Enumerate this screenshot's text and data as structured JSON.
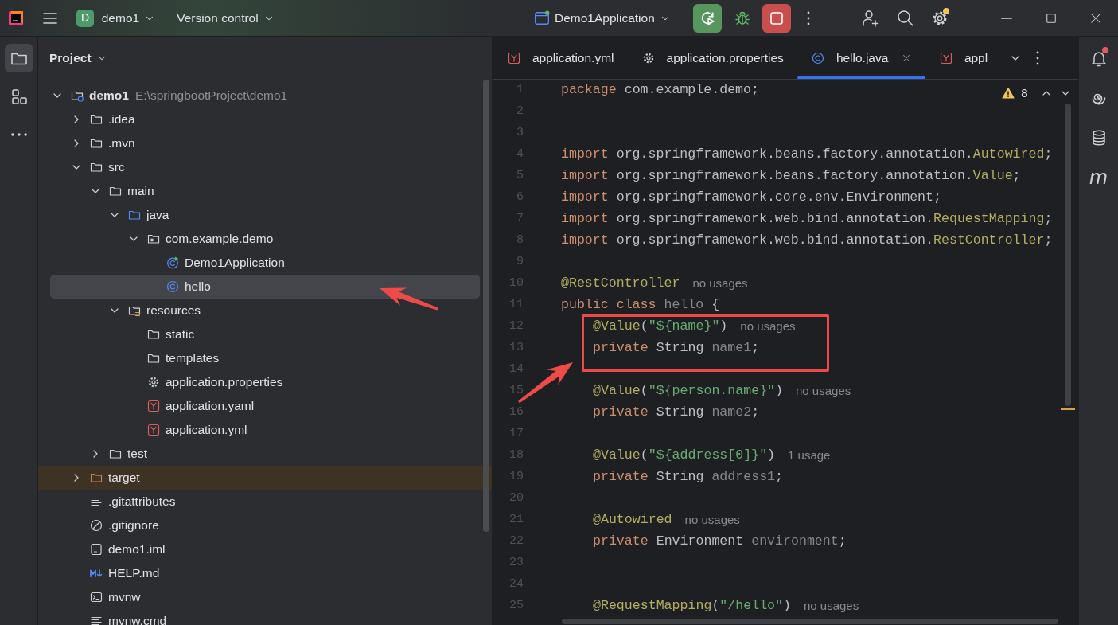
{
  "title_bar": {
    "project_badge": "D",
    "project": "demo1",
    "vcs": "Version control",
    "run_config": "Demo1Application",
    "settings_badge": true
  },
  "left_toolbar": [
    {
      "kind": "project",
      "selected": true
    },
    {
      "kind": "structure",
      "selected": false
    },
    {
      "kind": "more",
      "selected": false
    }
  ],
  "tool_window": {
    "title": "Project"
  },
  "tree": [
    {
      "label": "demo1",
      "kind": "module",
      "path": "E:\\springbootProject\\demo1",
      "expanded": true,
      "selected": false,
      "children": [
        {
          "label": ".idea",
          "kind": "folder",
          "expanded": false,
          "selected": false
        },
        {
          "label": ".mvn",
          "kind": "folder",
          "expanded": false,
          "selected": false
        },
        {
          "label": "src",
          "kind": "folder",
          "expanded": true,
          "selected": false,
          "children": [
            {
              "label": "main",
              "kind": "folder",
              "expanded": true,
              "selected": false,
              "children": [
                {
                  "label": "java",
                  "kind": "source-folder",
                  "expanded": true,
                  "selected": false,
                  "children": [
                    {
                      "label": "com.example.demo",
                      "kind": "package",
                      "expanded": true,
                      "selected": false,
                      "children": [
                        {
                          "label": "Demo1Application",
                          "kind": "spring-class",
                          "selected": false
                        },
                        {
                          "label": "hello",
                          "kind": "class",
                          "selected": true
                        }
                      ]
                    }
                  ]
                },
                {
                  "label": "resources",
                  "kind": "resources-folder",
                  "expanded": true,
                  "selected": false,
                  "children": [
                    {
                      "label": "static",
                      "kind": "folder",
                      "selected": false
                    },
                    {
                      "label": "templates",
                      "kind": "folder",
                      "selected": false
                    },
                    {
                      "label": "application.properties",
                      "kind": "settings",
                      "selected": false
                    },
                    {
                      "label": "application.yaml",
                      "kind": "yaml",
                      "selected": false
                    },
                    {
                      "label": "application.yml",
                      "kind": "yaml",
                      "selected": false
                    }
                  ]
                }
              ]
            },
            {
              "label": "test",
              "kind": "folder",
              "expanded": false,
              "selected": false
            }
          ]
        },
        {
          "label": "target",
          "kind": "excluded-folder",
          "expanded": false,
          "selected": false
        },
        {
          "label": ".gitattributes",
          "kind": "text",
          "selected": false
        },
        {
          "label": ".gitignore",
          "kind": "ignore",
          "selected": false
        },
        {
          "label": "demo1.iml",
          "kind": "iml",
          "selected": false
        },
        {
          "label": "HELP.md",
          "kind": "markdown",
          "selected": false
        },
        {
          "label": "mvnw",
          "kind": "shell",
          "selected": false
        },
        {
          "label": "mvnw.cmd",
          "kind": "text",
          "selected": false
        }
      ]
    }
  ],
  "tabs": [
    {
      "label": "application.yml",
      "kind": "yaml",
      "selected": false,
      "closable": false
    },
    {
      "label": "application.properties",
      "kind": "settings",
      "selected": false,
      "closable": false
    },
    {
      "label": "hello.java",
      "kind": "class",
      "selected": true,
      "closable": true
    },
    {
      "label": "appl",
      "kind": "yaml",
      "selected": false,
      "closable": false
    }
  ],
  "inspections": {
    "warnings": "8"
  },
  "code": [
    {
      "number": "1",
      "indented": false,
      "tokens": [
        {
          "kind": "kw",
          "text": "package"
        },
        {
          "kind": "plain",
          "text": " com.example.demo;"
        }
      ]
    },
    {
      "number": "2"
    },
    {
      "number": "3"
    },
    {
      "number": "4",
      "indented": false,
      "tokens": [
        {
          "kind": "kw",
          "text": "import"
        },
        {
          "kind": "plain",
          "text": " org.springframework.beans.factory.annotation."
        },
        {
          "kind": "ref",
          "text": "Autowired"
        },
        {
          "kind": "plain",
          "text": ";"
        }
      ]
    },
    {
      "number": "5",
      "indented": false,
      "tokens": [
        {
          "kind": "kw",
          "text": "import"
        },
        {
          "kind": "plain",
          "text": " org.springframework.beans.factory.annotation."
        },
        {
          "kind": "ref",
          "text": "Value"
        },
        {
          "kind": "plain",
          "text": ";"
        }
      ]
    },
    {
      "number": "6",
      "indented": false,
      "tokens": [
        {
          "kind": "kw",
          "text": "import"
        },
        {
          "kind": "plain",
          "text": " org.springframework.core.env.Environment;"
        }
      ]
    },
    {
      "number": "7",
      "indented": false,
      "tokens": [
        {
          "kind": "kw",
          "text": "import"
        },
        {
          "kind": "plain",
          "text": " org.springframework.web.bind.annotation."
        },
        {
          "kind": "ref",
          "text": "RequestMapping"
        },
        {
          "kind": "plain",
          "text": ";"
        }
      ]
    },
    {
      "number": "8",
      "indented": false,
      "tokens": [
        {
          "kind": "kw",
          "text": "import"
        },
        {
          "kind": "plain",
          "text": " org.springframework.web.bind.annotation."
        },
        {
          "kind": "ref",
          "text": "RestController"
        },
        {
          "kind": "plain",
          "text": ";"
        }
      ]
    },
    {
      "number": "9"
    },
    {
      "number": "10",
      "indented": false,
      "tokens": [
        {
          "kind": "anno",
          "text": "@RestController"
        },
        {
          "kind": "hint",
          "text": "no usages"
        }
      ]
    },
    {
      "number": "11",
      "indented": false,
      "tokens": [
        {
          "kind": "kw",
          "text": "public class "
        },
        {
          "kind": "unused",
          "text": "hello"
        },
        {
          "kind": "plain",
          "text": " {"
        }
      ]
    },
    {
      "number": "12",
      "indented": true,
      "tokens": [
        {
          "kind": "anno",
          "text": "@Value"
        },
        {
          "kind": "plain",
          "text": "("
        },
        {
          "kind": "str",
          "text": "\"${name}\""
        },
        {
          "kind": "plain",
          "text": ")"
        },
        {
          "kind": "hint",
          "text": "no usages"
        }
      ]
    },
    {
      "number": "13",
      "indented": true,
      "tokens": [
        {
          "kind": "kw",
          "text": "private "
        },
        {
          "kind": "plain",
          "text": "String "
        },
        {
          "kind": "unused",
          "text": "name1"
        },
        {
          "kind": "plain",
          "text": ";"
        }
      ]
    },
    {
      "number": "14"
    },
    {
      "number": "15",
      "indented": true,
      "tokens": [
        {
          "kind": "anno",
          "text": "@Value"
        },
        {
          "kind": "plain",
          "text": "("
        },
        {
          "kind": "str",
          "text": "\"${person.name}\""
        },
        {
          "kind": "plain",
          "text": ")"
        },
        {
          "kind": "hint",
          "text": "no usages"
        }
      ]
    },
    {
      "number": "16",
      "indented": true,
      "tokens": [
        {
          "kind": "kw",
          "text": "private "
        },
        {
          "kind": "plain",
          "text": "String "
        },
        {
          "kind": "unused",
          "text": "name2"
        },
        {
          "kind": "plain",
          "text": ";"
        }
      ]
    },
    {
      "number": "17"
    },
    {
      "number": "18",
      "indented": true,
      "tokens": [
        {
          "kind": "anno",
          "text": "@Value"
        },
        {
          "kind": "plain",
          "text": "("
        },
        {
          "kind": "str",
          "text": "\"${address[0]}\""
        },
        {
          "kind": "plain",
          "text": ")"
        },
        {
          "kind": "hint",
          "text": "1 usage"
        }
      ]
    },
    {
      "number": "19",
      "indented": true,
      "tokens": [
        {
          "kind": "kw",
          "text": "private "
        },
        {
          "kind": "plain",
          "text": "String "
        },
        {
          "kind": "unused",
          "text": "address1"
        },
        {
          "kind": "plain",
          "text": ";"
        }
      ]
    },
    {
      "number": "20"
    },
    {
      "number": "21",
      "indented": true,
      "tokens": [
        {
          "kind": "anno",
          "text": "@Autowired"
        },
        {
          "kind": "hint",
          "text": "no usages"
        }
      ]
    },
    {
      "number": "22",
      "indented": true,
      "tokens": [
        {
          "kind": "kw",
          "text": "private "
        },
        {
          "kind": "plain",
          "text": "Environment "
        },
        {
          "kind": "unused",
          "text": "environment"
        },
        {
          "kind": "plain",
          "text": ";"
        }
      ]
    },
    {
      "number": "23"
    },
    {
      "number": "24"
    },
    {
      "number": "25",
      "indented": true,
      "tokens": [
        {
          "kind": "anno",
          "text": "@RequestMapping"
        },
        {
          "kind": "plain",
          "text": "("
        },
        {
          "kind": "str",
          "text": "\"/hello\""
        },
        {
          "kind": "plain",
          "text": ")"
        },
        {
          "kind": "hint",
          "text": "no usages"
        }
      ]
    }
  ],
  "right_toolbar": [
    {
      "kind": "notifications",
      "badge": true
    },
    {
      "kind": "ai",
      "badge": false
    },
    {
      "kind": "database",
      "badge": false
    },
    {
      "kind": "maven",
      "glyph": "m",
      "badge": false
    }
  ]
}
